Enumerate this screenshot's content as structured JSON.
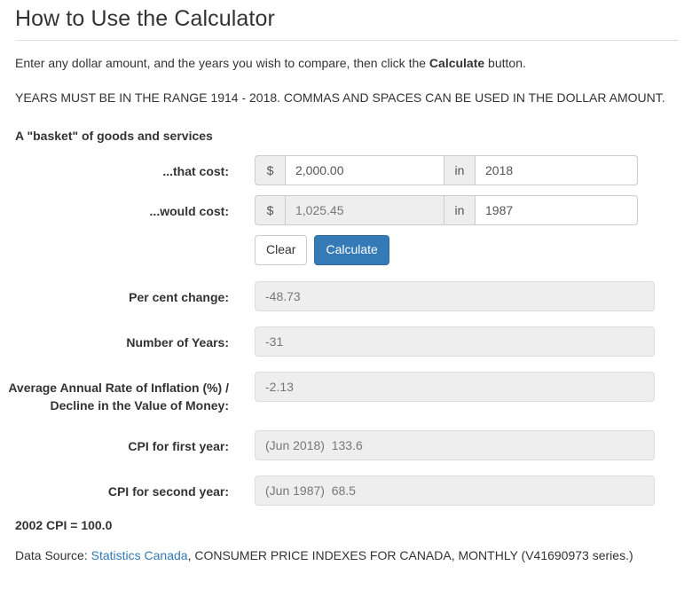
{
  "header": {
    "title": "How to Use the Calculator"
  },
  "intro": {
    "line1_before": "Enter any dollar amount, and the years you wish to compare, then click the ",
    "line1_bold": "Calculate",
    "line1_after": " button.",
    "line2": "YEARS MUST BE IN THE RANGE 1914 - 2018. COMMAS AND SPACES CAN BE USED IN THE DOLLAR AMOUNT."
  },
  "section": {
    "heading": "A \"basket\" of goods and services"
  },
  "form": {
    "that_cost": {
      "label": "...that cost:",
      "currency_addon": "$",
      "amount_value": "2,000.00",
      "in_addon": "in",
      "year_value": "2018"
    },
    "would_cost": {
      "label": "...would cost:",
      "currency_addon": "$",
      "amount_value": "1,025.45",
      "in_addon": "in",
      "year_value": "1987"
    },
    "buttons": {
      "clear": "Clear",
      "calculate": "Calculate"
    }
  },
  "results": [
    {
      "label": "Per cent change:",
      "value": "-48.73"
    },
    {
      "label": "Number of Years:",
      "value": "-31"
    },
    {
      "label": "Average Annual Rate of Inflation (%) / Decline in the Value of Money:",
      "value": "-2.13"
    },
    {
      "label": "CPI for first year:",
      "value": "(Jun 2018)  133.6"
    },
    {
      "label": "CPI for second year:",
      "value": "(Jun 1987)  68.5"
    }
  ],
  "footer": {
    "cpi_note": "2002 CPI = 100.0",
    "source_prefix": "Data Source: ",
    "source_link": "Statistics Canada",
    "source_suffix": ", CONSUMER PRICE INDEXES FOR CANADA, MONTHLY (V41690973 series.)"
  },
  "colors": {
    "primary": "#337ab7",
    "link": "#337ab7",
    "disabled_bg": "#eeeeee",
    "border": "#cccccc"
  }
}
